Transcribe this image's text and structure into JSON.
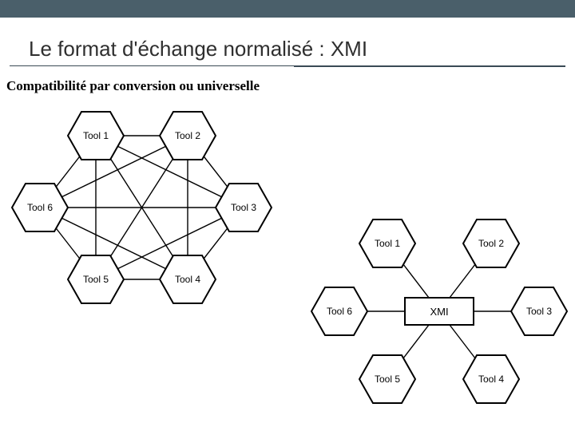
{
  "header": {
    "title": "Le format d'échange normalisé : XMI",
    "subtitle": "Compatibilité par conversion ou universelle"
  },
  "diagram_left": {
    "nodes": [
      "Tool 1",
      "Tool 2",
      "Tool 3",
      "Tool 4",
      "Tool 5",
      "Tool 6"
    ]
  },
  "diagram_right": {
    "center": "XMI",
    "nodes": [
      "Tool 1",
      "Tool 2",
      "Tool 3",
      "Tool 4",
      "Tool 5",
      "Tool 6"
    ]
  }
}
